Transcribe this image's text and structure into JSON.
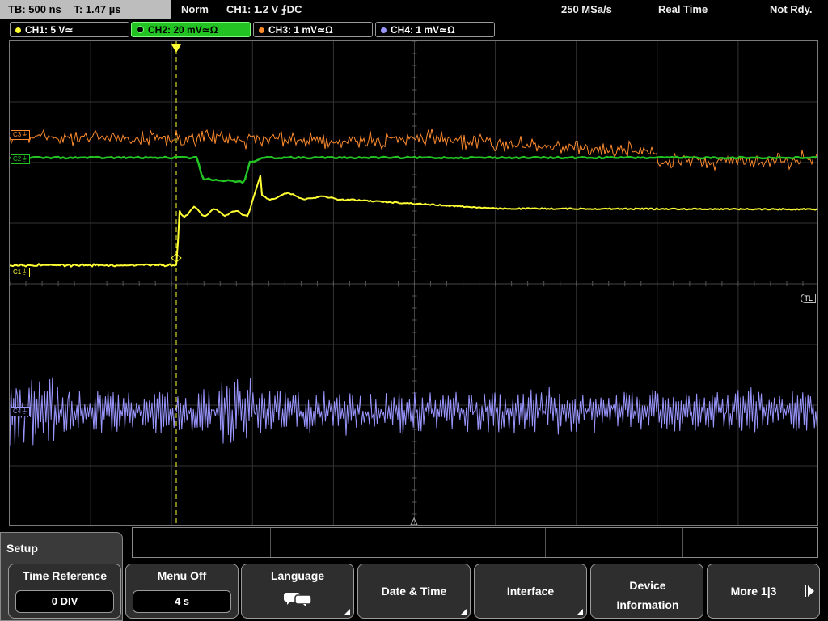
{
  "status": {
    "timebase": "TB: 500 ns",
    "trigger_time": "T: 1.47 µs",
    "mode": "Norm",
    "trigger": "CH1: 1.2 V ⨍DC",
    "sample_rate": "250 MSa/s",
    "acq_mode": "Real Time",
    "state": "Not Rdy."
  },
  "channels": [
    {
      "label": "CH1: 5 V≃",
      "color": "#ffff33"
    },
    {
      "label": "CH2: 20 mV≃Ω",
      "color": "#22c322"
    },
    {
      "label": "CH3: 1 mV≃Ω",
      "color": "#ff8c2e"
    },
    {
      "label": "CH4: 1 mV≃Ω",
      "color": "#9a96ff"
    }
  ],
  "markers": {
    "c1": "C1⏚",
    "c2": "C2⏚",
    "c3": "C3⏚",
    "c4": "C4⏚",
    "trigger_level": "TL"
  },
  "menu": {
    "title": "Setup",
    "keys": [
      {
        "label": "Time Reference",
        "value": "0 DIV"
      },
      {
        "label": "Menu Off",
        "value": "4 s"
      },
      {
        "label": "Language",
        "icon": "speech-bubbles-icon"
      },
      {
        "label": "Date & Time"
      },
      {
        "label": "Interface"
      },
      {
        "label": "Device Information"
      },
      {
        "label": "More 1|3"
      }
    ]
  },
  "colors": {
    "accent_green": "#22c322",
    "softkey_bg": "#2e2e2e",
    "grid": "#555555"
  }
}
